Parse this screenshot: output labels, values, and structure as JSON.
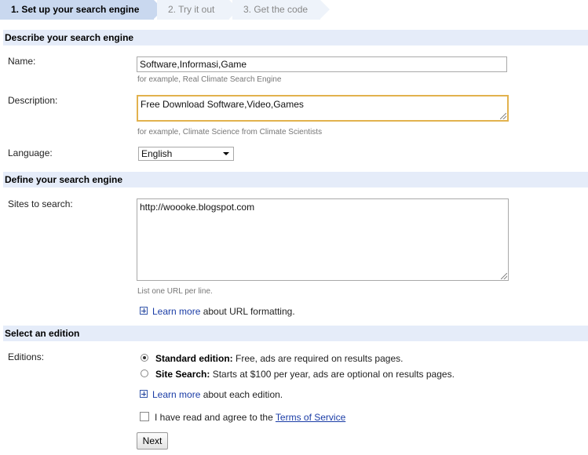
{
  "wizard": {
    "steps": [
      {
        "label": "1. Set up your search engine"
      },
      {
        "label": "2. Try it out"
      },
      {
        "label": "3. Get the code"
      }
    ]
  },
  "describe": {
    "heading": "Describe your search engine",
    "name_label": "Name:",
    "name_value": "Software,Informasi,Game",
    "name_hint": "for example, Real Climate Search Engine",
    "description_label": "Description:",
    "description_value": "Free Download Software,Video,Games",
    "description_hint": "for example, Climate Science from Climate Scientists",
    "language_label": "Language:",
    "language_value": "English"
  },
  "define": {
    "heading": "Define your search engine",
    "sites_label": "Sites to search:",
    "sites_value": "http://woooke.blogspot.com",
    "sites_hint": "List one URL per line.",
    "learn_more": "Learn more",
    "learn_more_rest": " about URL formatting."
  },
  "edition": {
    "heading": "Select an edition",
    "editions_label": "Editions:",
    "standard_name": "Standard edition:",
    "standard_desc": " Free, ads are required on results pages.",
    "site_search_name": "Site Search:",
    "site_search_desc": " Starts at $100 per year, ads are optional on results pages.",
    "learn_more": "Learn more",
    "learn_more_rest": " about each edition.",
    "tos_prefix": "I have read and agree to the ",
    "tos_link": "Terms of Service",
    "next_button": "Next"
  },
  "colors": {
    "active_step": "#c9d8ef",
    "section_bar": "#e5ecf9",
    "link": "#1a3ca6",
    "focus_border": "#e2b24e"
  }
}
